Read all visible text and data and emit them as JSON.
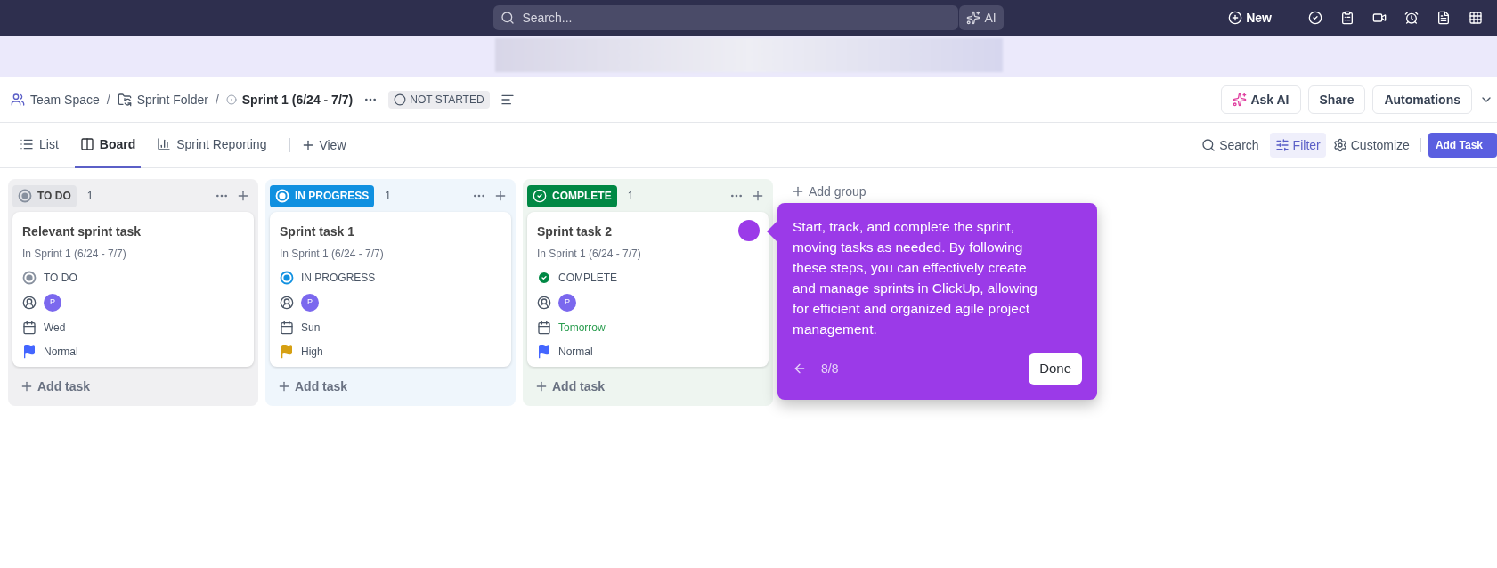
{
  "topbar": {
    "search_placeholder": "Search...",
    "ai_label": "AI",
    "new_label": "New"
  },
  "breadcrumb": {
    "items": [
      {
        "label": "Team Space",
        "kind": "space"
      },
      {
        "label": "Sprint Folder",
        "kind": "folder"
      },
      {
        "label": "Sprint 1 (6/24 - 7/7)",
        "kind": "sprint"
      }
    ],
    "separators": [
      "/",
      "/"
    ],
    "status": "NOT STARTED"
  },
  "header_actions": [
    "Ask AI",
    "Share",
    "Automations"
  ],
  "view_tabs": [
    {
      "label": "List",
      "kind": "list",
      "selected": false
    },
    {
      "label": "Board",
      "kind": "board",
      "selected": true
    },
    {
      "label": "Sprint Reporting",
      "kind": "report",
      "selected": false
    }
  ],
  "add_view": "View",
  "toolbar": {
    "search": "Search",
    "filter": "Filter",
    "customize": "Customize",
    "add_task": "Add Task"
  },
  "columns": [
    {
      "status": "TO DO",
      "kind": "todo",
      "color": "#87909e",
      "count": "1",
      "add_task": "Add task",
      "cards": [
        {
          "title": "Relevant sprint task",
          "sprint": "In Sprint 1 (6/24 - 7/7)",
          "status": "TO DO",
          "assignee": "P",
          "date": "Wed",
          "due_soon": false,
          "priority": {
            "label": "Normal",
            "color": "#4466ff"
          }
        }
      ]
    },
    {
      "status": "IN PROGRESS",
      "kind": "progress",
      "color": "#1090e0",
      "count": "1",
      "add_task": "Add task",
      "cards": [
        {
          "title": "Sprint task 1",
          "sprint": "In Sprint 1 (6/24 - 7/7)",
          "status": "IN PROGRESS",
          "assignee": "P",
          "date": "Sun",
          "due_soon": false,
          "priority": {
            "label": "High",
            "color": "#d6a013"
          }
        }
      ]
    },
    {
      "status": "COMPLETE",
      "kind": "complete",
      "color": "#008844",
      "count": "1",
      "add_task": "Add task",
      "cards": [
        {
          "title": "Sprint task 2",
          "sprint": "In Sprint 1 (6/24 - 7/7)",
          "status": "COMPLETE",
          "assignee": "P",
          "date": "Tomorrow",
          "due_soon": true,
          "priority": {
            "label": "Normal",
            "color": "#4466ff"
          }
        }
      ]
    }
  ],
  "add_group": "Add group",
  "tour": {
    "text": "Start, track, and complete the sprint, moving tasks as needed. By following these steps, you can effectively create and manage sprints in ClickUp, allowing for efficient and organized agile project management.",
    "step": "8/8",
    "button": "Done"
  }
}
